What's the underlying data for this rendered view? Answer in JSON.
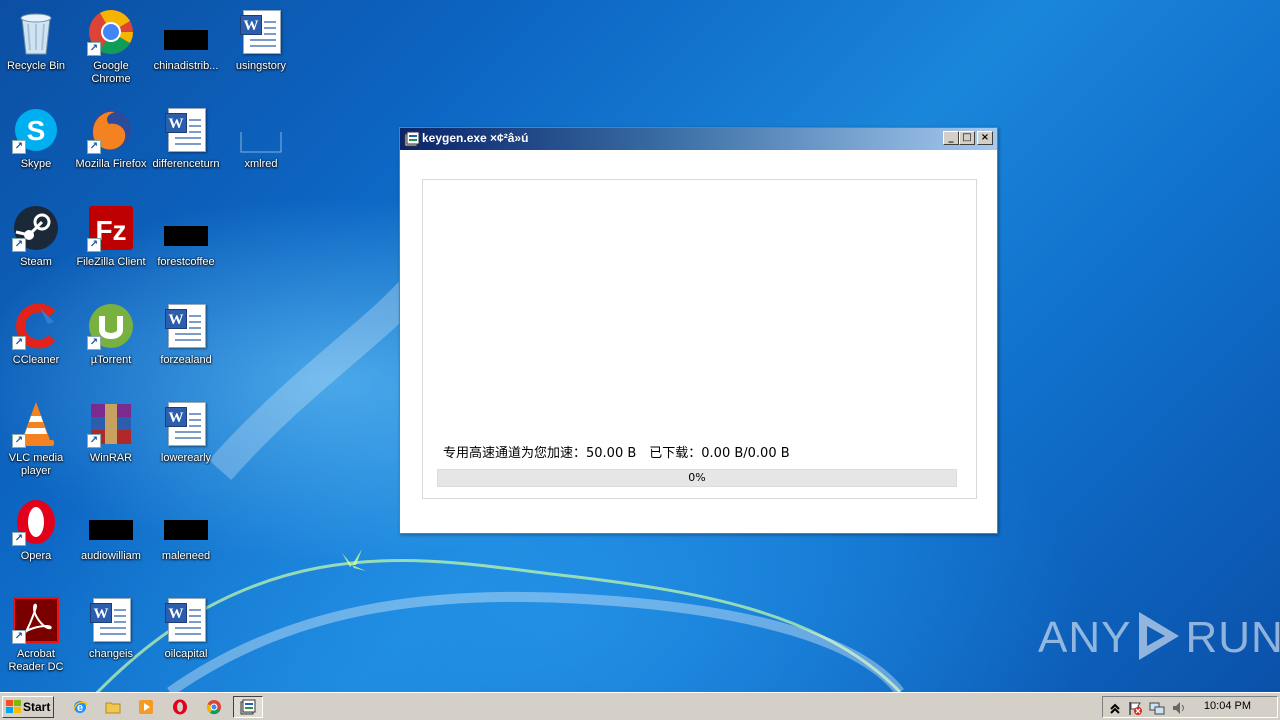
{
  "desktop_icons": [
    {
      "label": "Recycle Bin",
      "icon": "recycle-bin-icon"
    },
    {
      "label": "Google Chrome",
      "icon": "chrome-icon"
    },
    {
      "label": "chinadistrib...",
      "icon": "redacted-icon"
    },
    {
      "label": "usingstory",
      "icon": "word-document-icon"
    },
    {
      "label": "Skype",
      "icon": "skype-icon"
    },
    {
      "label": "Mozilla Firefox",
      "icon": "firefox-icon"
    },
    {
      "label": "differenceturn",
      "icon": "word-document-icon"
    },
    {
      "label": "xmlred",
      "icon": "blank-file-icon"
    },
    {
      "label": "Steam",
      "icon": "steam-icon"
    },
    {
      "label": "FileZilla Client",
      "icon": "filezilla-icon"
    },
    {
      "label": "forestcoffee",
      "icon": "redacted-icon"
    },
    {
      "label": "CCleaner",
      "icon": "ccleaner-icon"
    },
    {
      "label": "µTorrent",
      "icon": "utorrent-icon"
    },
    {
      "label": "forzealand",
      "icon": "word-document-icon"
    },
    {
      "label": "VLC media player",
      "icon": "vlc-icon"
    },
    {
      "label": "WinRAR",
      "icon": "winrar-icon"
    },
    {
      "label": "lowerearly",
      "icon": "word-document-icon"
    },
    {
      "label": "Opera",
      "icon": "opera-icon"
    },
    {
      "label": "audiowilliam",
      "icon": "redacted-icon"
    },
    {
      "label": "maleneed",
      "icon": "redacted-icon"
    },
    {
      "label": "Acrobat Reader DC",
      "icon": "acrobat-icon"
    },
    {
      "label": "changeis",
      "icon": "word-document-icon"
    },
    {
      "label": "oilcapital",
      "icon": "word-document-icon"
    }
  ],
  "window": {
    "title": "keygen.exe ×¢²â»ú",
    "buttons": {
      "minimize": "_",
      "maximize": "□",
      "close": "×"
    },
    "status_text": "专用高速通道为您加速：50.00 B　已下载：0.00 B/0.00 B",
    "progress_percent": 0,
    "progress_label": "0%"
  },
  "taskbar": {
    "start_label": "Start",
    "quick_launch": [
      "internet-explorer-icon",
      "explorer-folder-icon",
      "media-player-icon",
      "opera-icon",
      "chrome-icon"
    ],
    "active_task_icon": "keygen-app-icon",
    "tray_icons": [
      "expand-tray-icon",
      "action-center-flag-icon",
      "network-icon",
      "volume-icon"
    ],
    "clock": "10:04 PM"
  },
  "watermark": {
    "left": "ANY",
    "right": "RUN"
  }
}
